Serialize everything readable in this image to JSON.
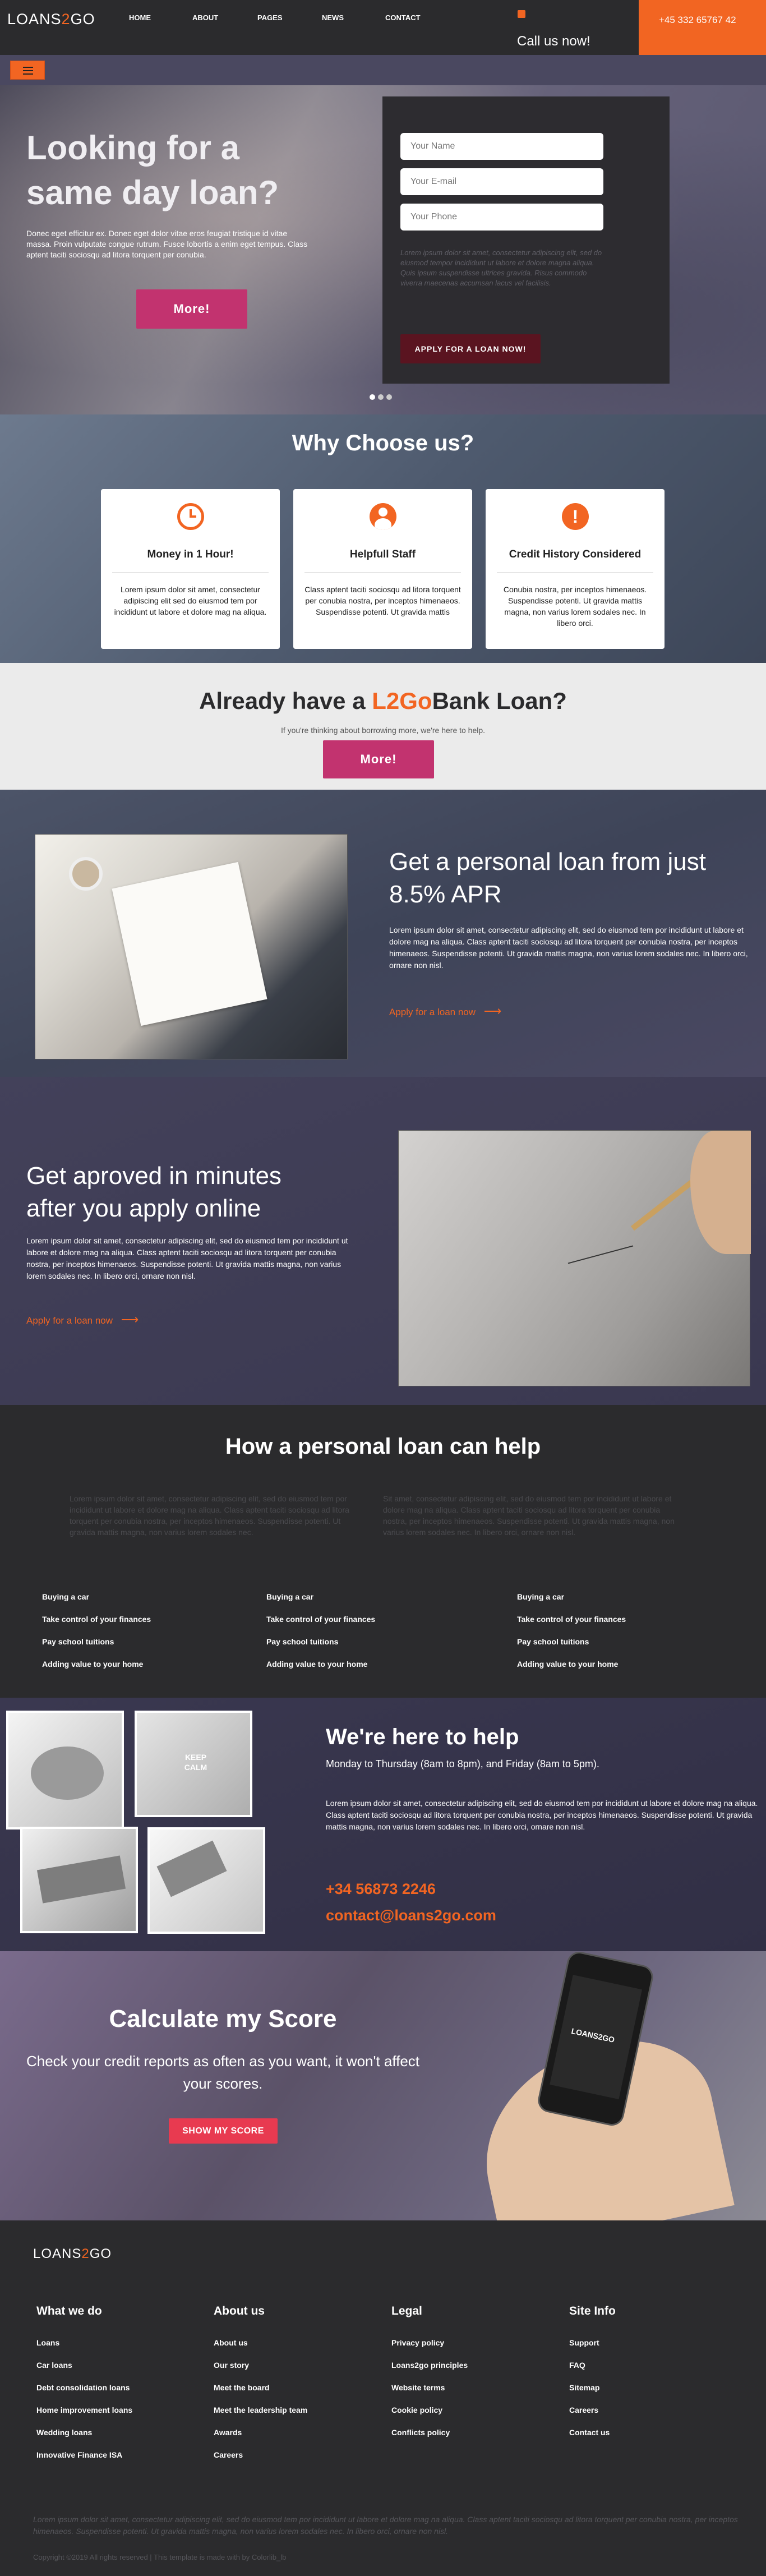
{
  "header": {
    "logo_pre": "LOANS",
    "logo_accent": "2",
    "logo_post": "GO",
    "nav": [
      "HOME",
      "ABOUT",
      "PAGES",
      "NEWS",
      "CONTACT"
    ],
    "call_label": "Call us now!",
    "phone": "+45 332 65767 42"
  },
  "hero": {
    "title_line1": "Looking for a",
    "title_line2": "same day loan?",
    "text": "Donec eget efficitur ex. Donec eget dolor vitae eros feugiat tristique id vitae massa. Proin vulputate congue rutrum. Fusce lobortis a enim eget tempus. Class aptent taciti sociosqu ad litora torquent per conubia.",
    "more_button": "More!",
    "form": {
      "name_placeholder": "Your Name",
      "email_placeholder": "Your E-mail",
      "phone_placeholder": "Your Phone",
      "note": "Lorem ipsum dolor sit amet, consectetur adipiscing elit, sed do eiusmod tempor incididunt ut labore et dolore magna aliqua. Quis ipsum suspendisse ultrices gravida. Risus commodo viverra maecenas accumsan lacus vel facilisis.",
      "submit": "APPLY FOR A LOAN NOW!"
    }
  },
  "why": {
    "title": "Why Choose us?",
    "cards": [
      {
        "icon": "clock-icon",
        "title": "Money in 1 Hour!",
        "text": "Lorem ipsum dolor sit amet, consectetur adipiscing elit sed do eiusmod tem por incididunt ut labore et dolore mag na aliqua."
      },
      {
        "icon": "user-icon",
        "title": "Helpfull Staff",
        "text": "Class aptent taciti sociosqu ad litora torquent per conubia nostra, per inceptos himenaeos. Suspendisse potenti. Ut gravida mattis"
      },
      {
        "icon": "alert-icon",
        "title": "Credit History Considered",
        "text": "Conubia nostra, per inceptos himenaeos. Suspendisse potenti. Ut gravida mattis magna, non varius lorem sodales nec. In libero orci."
      }
    ]
  },
  "already": {
    "title_pre": "Already have a ",
    "title_accent": "L2Go",
    "title_post": "Bank Loan?",
    "sub": "If you're thinking about borrowing more, we're here to help.",
    "button": "More!"
  },
  "personal": {
    "title": "Get a personal loan from just 8.5% APR",
    "text": "Lorem ipsum dolor sit amet, consectetur adipiscing elit, sed do eiusmod tem por incididunt ut labore et dolore mag na aliqua. Class aptent taciti sociosqu ad litora torquent per conubia nostra, per inceptos himenaeos. Suspendisse potenti. Ut gravida mattis magna, non varius lorem sodales nec. In libero orci, ornare non nisl.",
    "link": "Apply for a loan now"
  },
  "approved": {
    "title_line1": "Get aproved in minutes",
    "title_line2": "after you apply online",
    "text": "Lorem ipsum dolor sit amet, consectetur adipiscing elit, sed do eiusmod tem por incididunt ut labore et dolore mag na aliqua. Class aptent taciti sociosqu ad litora torquent per conubia nostra, per inceptos himenaeos. Suspendisse potenti. Ut gravida mattis magna, non varius lorem sodales nec. In libero orci, ornare non nisl.",
    "link": "Apply for a loan now"
  },
  "howhelp": {
    "title": "How a personal loan can help",
    "text_left": "Lorem ipsum dolor sit amet, consectetur adipiscing elit, sed do eiusmod tem por incididunt ut labore et dolore mag na aliqua. Class aptent taciti sociosqu ad litora torquent per conubia nostra, per inceptos himenaeos. Suspendisse potenti. Ut gravida mattis magna, non varius lorem sodales nec.",
    "text_right": "Sit amet, consectetur adipiscing elit, sed do eiusmod tem por incididunt ut labore et dolore mag na aliqua. Class aptent taciti sociosqu ad litora torquent per conubia nostra, per inceptos himenaeos. Suspendisse potenti. Ut gravida mattis magna, non varius lorem sodales nec. In libero orci, ornare non nisl.",
    "lists": [
      [
        "Buying a car",
        "Take control of your finances",
        "Pay school tuitions",
        "Adding value to your home"
      ],
      [
        "Buying a car",
        "Take control of your finances",
        "Pay school tuitions",
        "Adding value to your home"
      ],
      [
        "Buying a car",
        "Take control of your finances",
        "Pay school tuitions",
        "Adding value to your home"
      ]
    ]
  },
  "help": {
    "keep_calm_line1": "KEEP",
    "keep_calm_line2": "CALM",
    "title": "We're here to help",
    "hours": "Monday to Thursday (8am to 8pm), and Friday (8am to 5pm).",
    "text": "Lorem ipsum dolor sit amet, consectetur adipiscing elit, sed do eiusmod tem por incididunt ut labore et dolore mag na aliqua. Class aptent taciti sociosqu ad litora torquent per conubia nostra, per inceptos himenaeos. Suspendisse potenti. Ut gravida mattis magna, non varius lorem sodales nec. In libero orci, ornare non nisl.",
    "phone": "+34 56873 2246",
    "email": "contact@loans2go.com"
  },
  "score": {
    "title": "Calculate my Score",
    "text": "Check your credit reports as often as you want, it won't affect your scores.",
    "button": "SHOW MY SCORE",
    "phone_logo": "LOANS2GO"
  },
  "footer": {
    "logo_pre": "LOANS",
    "logo_accent": "2",
    "logo_post": "GO",
    "cols": [
      {
        "title": "What we do",
        "items": [
          "Loans",
          "Car loans",
          "Debt consolidation loans",
          "Home improvement loans",
          "Wedding loans",
          "Innovative Finance ISA"
        ]
      },
      {
        "title": "About us",
        "items": [
          "About us",
          "Our story",
          "Meet the board",
          "Meet the leadership team",
          "Awards",
          "Careers"
        ]
      },
      {
        "title": "Legal",
        "items": [
          "Privacy policy",
          "Loans2go principles",
          "Website terms",
          "Cookie policy",
          "Conflicts policy"
        ]
      },
      {
        "title": "Site Info",
        "items": [
          "Support",
          "FAQ",
          "Sitemap",
          "Careers",
          "Contact us"
        ]
      }
    ],
    "disclaimer": "Lorem ipsum dolor sit amet, consectetur adipiscing elit, sed do eiusmod tem por incididunt ut labore et dolore mag na aliqua. Class aptent taciti sociosqu ad litora torquent per conubia nostra, per inceptos himenaeos. Suspendisse potenti. Ut gravida mattis magna, non varius lorem sodales nec. In libero orci, ornare non nisl.",
    "copyright": "Copyright ©2019 All rights reserved | This template is made with by Colorlib_lb"
  },
  "colors": {
    "accent": "#f26522",
    "pink": "#c2336f",
    "dark": "#2b2b2d",
    "purple": "#3b3850"
  }
}
